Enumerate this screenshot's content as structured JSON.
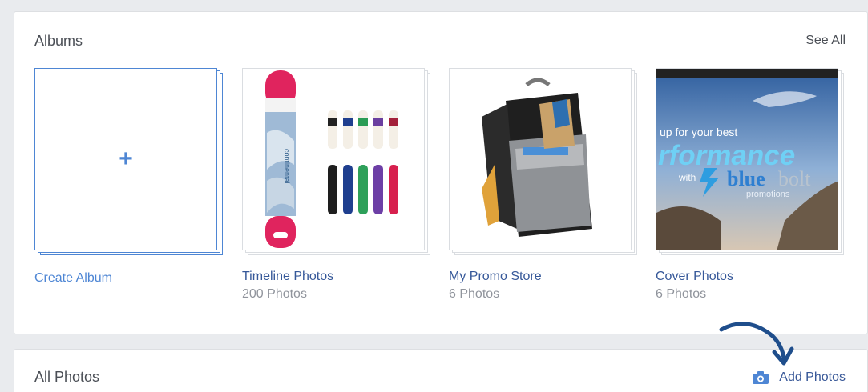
{
  "albums_section": {
    "title": "Albums",
    "see_all": "See All",
    "create_album": {
      "label": "Create Album",
      "icon": "plus-icon"
    },
    "albums": [
      {
        "name": "Timeline Photos",
        "count": "200 Photos"
      },
      {
        "name": "My Promo Store",
        "count": "6 Photos"
      },
      {
        "name": "Cover Photos",
        "count": "6 Photos"
      }
    ],
    "cover_banner": {
      "line1": "up for your best",
      "line2": "rformance",
      "with": "with",
      "brand_blue": "blue",
      "brand_bolt": "bolt",
      "brand_sub": "promotions"
    }
  },
  "photos_section": {
    "title": "All Photos",
    "add_photos": "Add Photos",
    "add_photos_icon": "camera-icon"
  },
  "colors": {
    "link": "#365899",
    "accent": "#4e86d4",
    "arrow": "#1f4e8c"
  }
}
